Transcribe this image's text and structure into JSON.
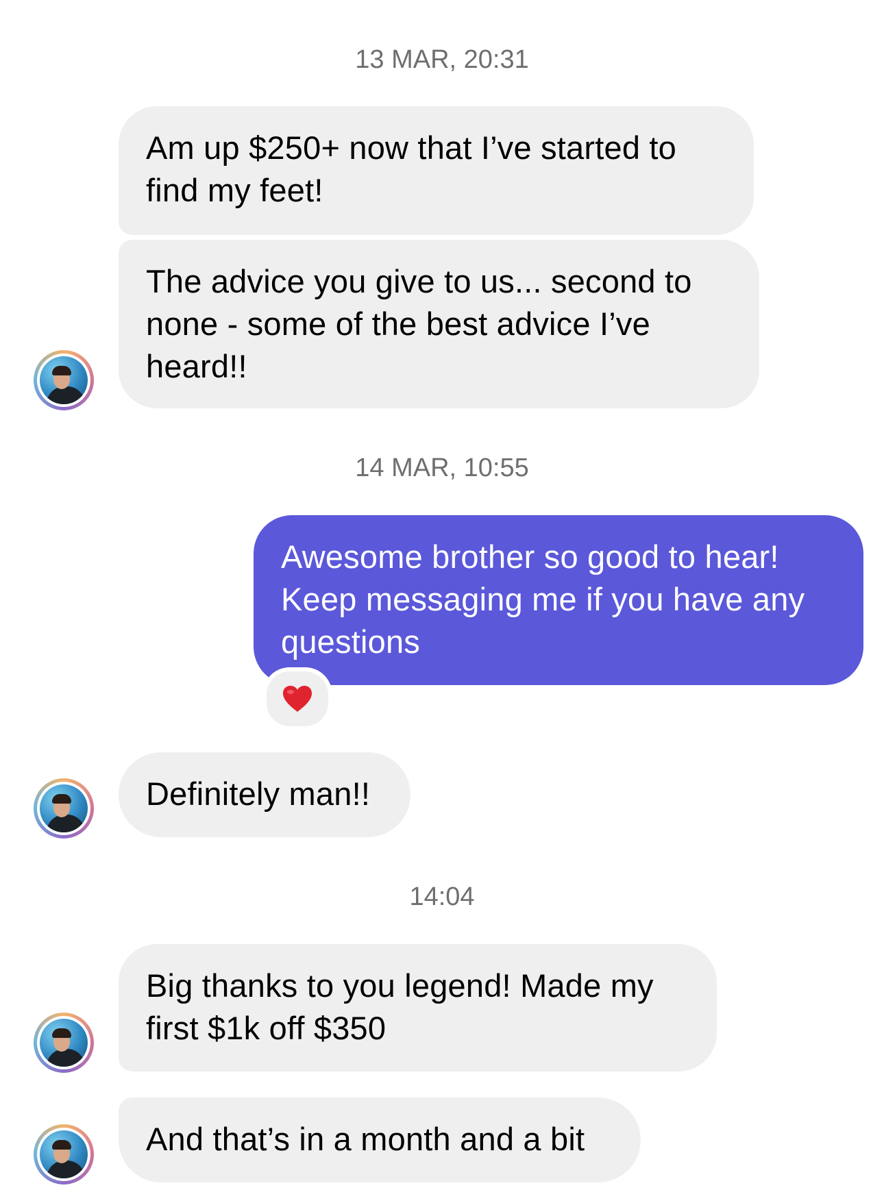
{
  "conversation": {
    "timestamps": {
      "first": "13 MAR, 20:31",
      "second": "14 MAR, 10:55",
      "third": "14:04"
    },
    "messages": [
      {
        "sender": "them",
        "text": "Am up $250+ now that I’ve started to find my feet!"
      },
      {
        "sender": "them",
        "text": "The advice you give to us... second to none - some of the best advice I’ve heard!!"
      },
      {
        "sender": "me",
        "text": "Awesome brother so good to hear! Keep messaging me if you have any questions",
        "reaction": "heart"
      },
      {
        "sender": "them",
        "text": "Definitely man!!"
      },
      {
        "sender": "them",
        "text": "Big thanks to you legend! Made my first $1k off $350"
      },
      {
        "sender": "them",
        "text": "And that’s in a month and a bit"
      }
    ]
  },
  "icons": {
    "avatar": "profile-avatar",
    "reaction": "red-heart-icon"
  },
  "colors": {
    "incoming_bubble": "#efefef",
    "outgoing_bubble": "#5b58da",
    "timestamp": "#6e6e6e",
    "heart": "#e0242f"
  }
}
